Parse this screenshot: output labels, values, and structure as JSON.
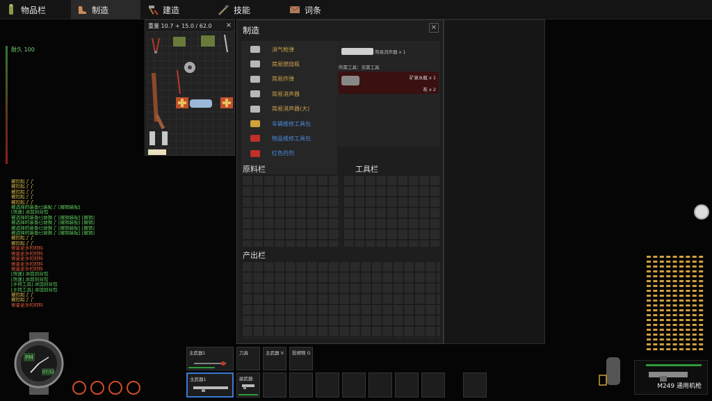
{
  "tabs": [
    {
      "label": "物品栏",
      "icon": "bottle-icon"
    },
    {
      "label": "制造",
      "icon": "boot-icon",
      "active": true
    },
    {
      "label": "建造",
      "icon": "hammer-icon"
    },
    {
      "label": "技能",
      "icon": "rifle-icon"
    },
    {
      "label": "词条",
      "icon": "envelope-icon"
    }
  ],
  "status": {
    "durability": "耐久 100"
  },
  "log": [
    {
      "text": "被捡起了了",
      "color": "#e0c04a"
    },
    {
      "text": "被捡起了了",
      "color": "#e0c04a"
    },
    {
      "text": "被捡起了了",
      "color": "#e0c04a"
    },
    {
      "text": "被捡起了了",
      "color": "#e0c04a"
    },
    {
      "text": "被捡起了了",
      "color": "#e0c04a"
    },
    {
      "text": "被选择的装备已装配了 [撤销装配]",
      "color": "#5fd15f"
    },
    {
      "text": "[快速] 添加到背包",
      "color": "#5fd15f"
    },
    {
      "text": "被选择的装备已替换了 [撤销装配] [撤销]",
      "color": "#5fd15f"
    },
    {
      "text": "被选择的装备已替换了 [撤销装配] [撤销]",
      "color": "#5fd15f"
    },
    {
      "text": "被选择的装备已替换了 [撤销装配] [撤销]",
      "color": "#5fd15f"
    },
    {
      "text": "被选择的装备已替换了 [撤销装配] [撤销]",
      "color": "#5fd15f"
    },
    {
      "text": "被捡起了了",
      "color": "#e0c04a"
    },
    {
      "text": "被捡起了了",
      "color": "#e0c04a"
    },
    {
      "text": "需要更多的材料",
      "color": "#e05a3a"
    },
    {
      "text": "需要更多的材料",
      "color": "#e05a3a"
    },
    {
      "text": "需要更多的材料",
      "color": "#e05a3a"
    },
    {
      "text": "需要更多的材料",
      "color": "#e05a3a"
    },
    {
      "text": "需要更多的材料",
      "color": "#e05a3a"
    },
    {
      "text": "[快速] 添加到背包",
      "color": "#5fd15f"
    },
    {
      "text": "[快速] 添加到背包",
      "color": "#5fd15f"
    },
    {
      "text": "[手持工具] 添加到背包",
      "color": "#5fd15f"
    },
    {
      "text": "[手持工具] 添加到背包",
      "color": "#5fd15f"
    },
    {
      "text": "被捡起了了",
      "color": "#e0c04a"
    },
    {
      "text": "被捡起了了",
      "color": "#e0c04a"
    },
    {
      "text": "需要更多的材料",
      "color": "#e05a3a"
    }
  ],
  "inventory": {
    "weight": "重量 10.7 + 15.0 / 62.0",
    "close": "×"
  },
  "craft": {
    "title": "制造",
    "close": "×",
    "recipes": [
      {
        "label": "消气枪弹",
        "color": "#c9a04a"
      },
      {
        "label": "简易燃烧瓶",
        "color": "#c9a04a"
      },
      {
        "label": "简易炸弹",
        "color": "#c9a04a"
      },
      {
        "label": "简易消声器",
        "color": "#c9a04a"
      },
      {
        "label": "简易消声器(大)",
        "color": "#c9a04a"
      },
      {
        "label": "车辆维修工具包",
        "color": "#4a8ad8"
      },
      {
        "label": "物品维修工具包",
        "color": "#4a8ad8"
      },
      {
        "label": "红色药剂",
        "color": "#4a8ad8"
      }
    ],
    "detail": {
      "name": "简易消声器 x 1",
      "tools": "所需工具：无需工具",
      "req1": "矿泉水瓶 x 1",
      "req2": "布 x 2"
    },
    "materials_label": "原料栏",
    "tools_label": "工具栏",
    "output_label": "产出栏"
  },
  "quickslots": [
    {
      "label": "主武器1",
      "hotkey": ""
    },
    {
      "label": "刀具",
      "hotkey": ""
    },
    {
      "label": "主武器",
      "hotkey": "V"
    },
    {
      "label": "投掷物",
      "hotkey": "G"
    },
    {
      "label": "主武器1",
      "hotkey": ""
    },
    {
      "label": "副武器",
      "hotkey": ""
    }
  ],
  "watch": {
    "period": "PM",
    "time": "07:52"
  },
  "weapon": {
    "name": "M249 通用机枪"
  },
  "colors": {
    "accent": "#2f9a3a",
    "danger": "#d04b2a",
    "panel": "#1e1e1e"
  }
}
